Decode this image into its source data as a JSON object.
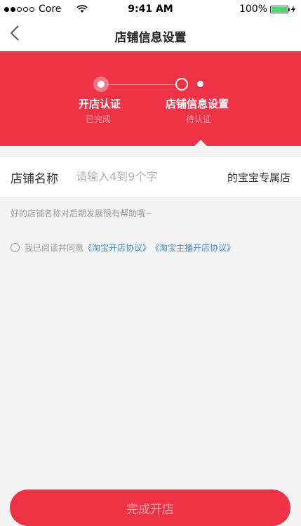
{
  "status_bar": {
    "carrier": "Core",
    "time": "9:41 AM",
    "battery_percent": "100%"
  },
  "nav": {
    "title": "店铺信息设置"
  },
  "steps": [
    {
      "label": "开店认证",
      "status": "已完成"
    },
    {
      "label": "店铺信息设置",
      "status": "待认证"
    }
  ],
  "form": {
    "name_label": "店铺名称",
    "name_placeholder": "请输入4到9个字",
    "name_value": "",
    "name_suffix": "的宝宝专属店",
    "hint": "好的店铺名称对后期发展很有帮助哦~"
  },
  "agreement": {
    "prefix": "我已阅读并同意",
    "link1": "《淘宝开店协议》",
    "link2": "《淘宝主播开店协议》",
    "checked": false
  },
  "submit_label": "完成开店",
  "colors": {
    "brand_red": "#ee3347",
    "link_blue": "#3a8fd9"
  }
}
